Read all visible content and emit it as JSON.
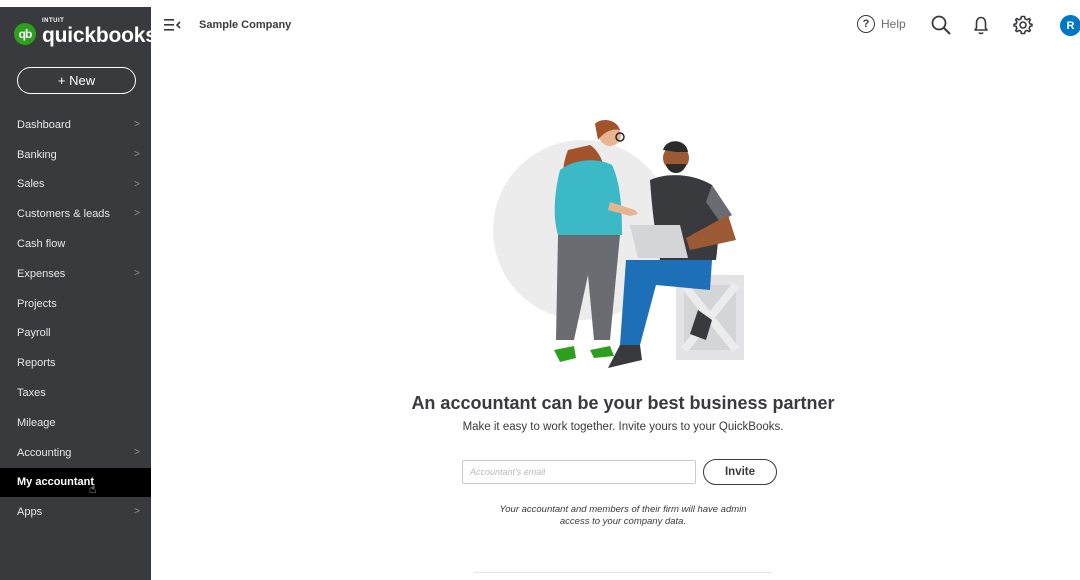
{
  "logo": {
    "intuit": "INTUIT",
    "name": "quickbooks.",
    "mark": "qb"
  },
  "new_button": "+ New",
  "nav": [
    {
      "label": "Dashboard",
      "chevron": ">"
    },
    {
      "label": "Banking",
      "chevron": ">"
    },
    {
      "label": "Sales",
      "chevron": ">"
    },
    {
      "label": "Customers & leads",
      "chevron": ">"
    },
    {
      "label": "Cash flow",
      "chevron": ""
    },
    {
      "label": "Expenses",
      "chevron": ">"
    },
    {
      "label": "Projects",
      "chevron": ""
    },
    {
      "label": "Payroll",
      "chevron": ""
    },
    {
      "label": "Reports",
      "chevron": ""
    },
    {
      "label": "Taxes",
      "chevron": ""
    },
    {
      "label": "Mileage",
      "chevron": ""
    },
    {
      "label": "Accounting",
      "chevron": ">"
    },
    {
      "label": "My accountant",
      "chevron": "",
      "active": true
    },
    {
      "label": "Apps",
      "chevron": ">"
    }
  ],
  "topbar": {
    "company": "Sample Company",
    "help_label": "Help",
    "help_glyph": "?",
    "avatar_initial": "R",
    "icons": [
      "menu-toggle-icon",
      "search-icon",
      "bell-icon",
      "gear-icon"
    ]
  },
  "main": {
    "headline": "An accountant can be your best business partner",
    "subline": "Make it easy to work together. Invite yours to your QuickBooks.",
    "email_placeholder": "Accountant's email",
    "invite_label": "Invite",
    "note_line1": "Your accountant and members of their firm will have admin",
    "note_line2": "access to your company data."
  },
  "colors": {
    "sidebar": "#393a3d",
    "active_nav": "#000000",
    "brand_green": "#2ca01c",
    "avatar_blue": "#0077c5"
  }
}
